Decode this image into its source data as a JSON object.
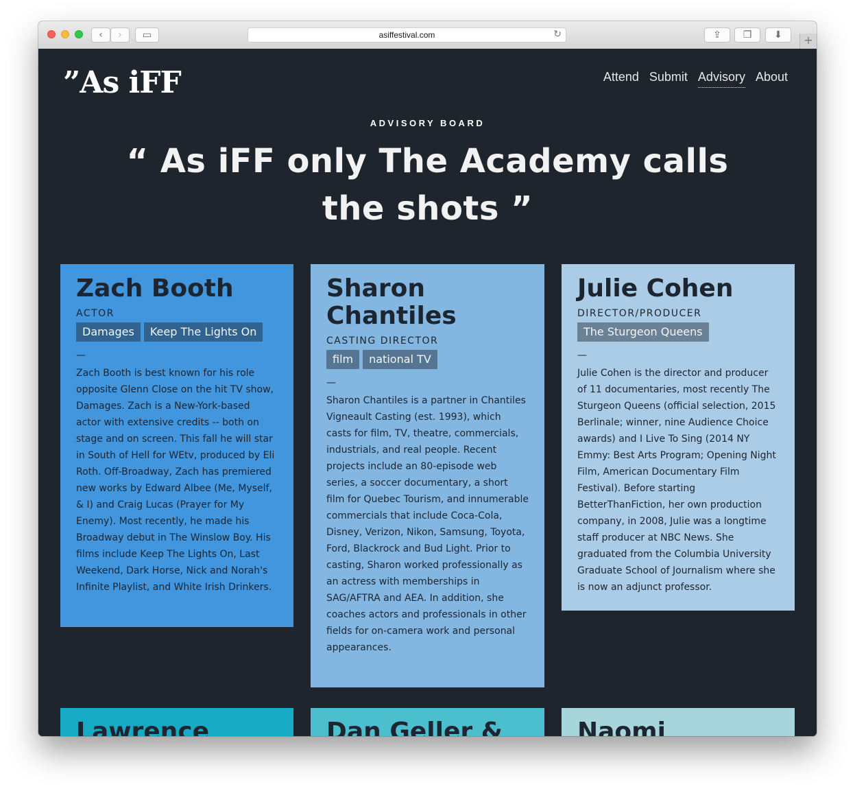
{
  "browser": {
    "url": "asiffestival.com",
    "back_icon": "‹",
    "forward_icon": "›",
    "sidebar_icon": "▭",
    "reload_icon": "↻",
    "share_icon": "⇪",
    "tabs_icon": "❐",
    "download_icon": "⬇",
    "newtab_icon": "+"
  },
  "site": {
    "logo": "”As iFF",
    "nav": [
      "Attend",
      "Submit",
      "Advisory",
      "About"
    ],
    "active_nav": "Advisory"
  },
  "hero": {
    "eyebrow": "ADVISORY BOARD",
    "headline": "“ As iFF only The Academy calls the shots ”"
  },
  "cards": [
    {
      "name": "Zach Booth",
      "role": "ACTOR",
      "tags": [
        "Damages",
        "Keep The Lights On"
      ],
      "dash": "—",
      "bio": "Zach Booth is best known for his role opposite Glenn Close on the hit TV show, Damages. Zach is a New-York-based actor with extensive credits -- both on stage and on screen. This fall he will star in South of Hell for WEtv, produced by Eli Roth. Off-Broadway, Zach has premiered new works by Edward Albee (Me, Myself, & I) and Craig Lucas (Prayer for My Enemy). Most recently, he made his Broadway debut in The Winslow Boy. His films include Keep The Lights On, Last Weekend, Dark Horse, Nick and Norah's Infinite Playlist, and White Irish Drinkers.",
      "color": "#4196dd"
    },
    {
      "name": "Sharon Chantiles",
      "role": "CASTING DIRECTOR",
      "tags": [
        "film",
        "national TV"
      ],
      "dash": "—",
      "bio": "Sharon Chantiles is a partner in Chantiles Vigneault Casting (est. 1993), which casts for film, TV, theatre, commercials, industrials, and real people. Recent projects include an 80-episode web series, a soccer documentary, a short film for Quebec Tourism, and innumerable commercials that include Coca-Cola, Disney, Verizon, Nikon, Samsung, Toyota, Ford, Blackrock and Bud Light. Prior to casting, Sharon worked professionally as an actress with memberships in SAG/AFTRA and AEA. In addition, she coaches actors and professionals in other fields for on-camera work and personal appearances.",
      "color": "#83b7e2"
    },
    {
      "name": "Julie Cohen",
      "role": "DIRECTOR/PRODUCER",
      "tags": [
        "The Sturgeon Queens"
      ],
      "dash": "—",
      "bio": "Julie Cohen is the director and producer of 11 documentaries, most recently The Sturgeon Queens (official selection, 2015 Berlinale; winner, nine Audience Choice awards) and I Live To Sing (2014 NY Emmy: Best Arts Program; Opening Night Film, American Documentary Film Festival). Before starting BetterThanFiction, her own production company, in 2008, Julie was a longtime staff producer at NBC News. She graduated from the Columbia University Graduate School of Journalism where she is now an adjunct professor.",
      "color": "#abcce6"
    }
  ],
  "next_cards": [
    {
      "name": "Lawrence",
      "color": "#17aac4"
    },
    {
      "name": "Dan Geller &",
      "color": "#4cbfce"
    },
    {
      "name": "Naomi",
      "color": "#a6d6dc"
    }
  ]
}
